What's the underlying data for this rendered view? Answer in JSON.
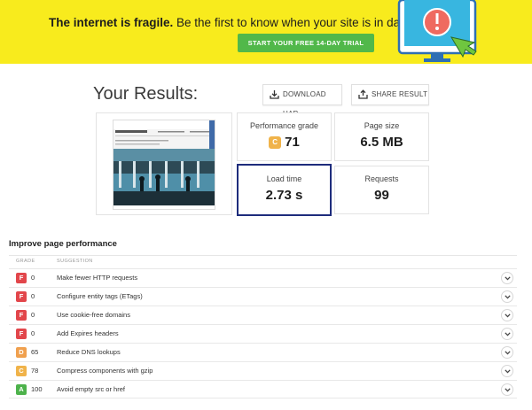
{
  "banner": {
    "headline_bold": "The internet is fragile.",
    "headline_rest": " Be the first to know when your site is in danger.",
    "cta_label": "START YOUR FREE 14-DAY TRIAL"
  },
  "header": {
    "title": "Your Results:",
    "download_label": "DOWNLOAD HAR",
    "share_label": "SHARE RESULT"
  },
  "metrics": {
    "performance": {
      "label": "Performance grade",
      "grade": "C",
      "value": "71"
    },
    "page_size": {
      "label": "Page size",
      "value": "6.5 MB"
    },
    "load_time": {
      "label": "Load time",
      "value": "2.73 s"
    },
    "requests": {
      "label": "Requests",
      "value": "99"
    }
  },
  "improve": {
    "title": "Improve page performance",
    "columns": {
      "grade": "GRADE",
      "suggestion": "SUGGESTION"
    },
    "rows": [
      {
        "grade": "F",
        "score": "0",
        "suggestion": "Make fewer HTTP requests"
      },
      {
        "grade": "F",
        "score": "0",
        "suggestion": "Configure entity tags (ETags)"
      },
      {
        "grade": "F",
        "score": "0",
        "suggestion": "Use cookie-free domains"
      },
      {
        "grade": "F",
        "score": "0",
        "suggestion": "Add Expires headers"
      },
      {
        "grade": "D",
        "score": "65",
        "suggestion": "Reduce DNS lookups"
      },
      {
        "grade": "C",
        "score": "78",
        "suggestion": "Compress components with gzip"
      },
      {
        "grade": "A",
        "score": "100",
        "suggestion": "Avoid empty src or href"
      }
    ]
  },
  "colors": {
    "banner_bg": "#f8eb1d",
    "cta_bg": "#51b84a",
    "grade_F": "#e2464b",
    "grade_D": "#f0a04e",
    "grade_C": "#f0b34a",
    "grade_A": "#4db24b",
    "highlight_border": "#1e2c7c"
  }
}
